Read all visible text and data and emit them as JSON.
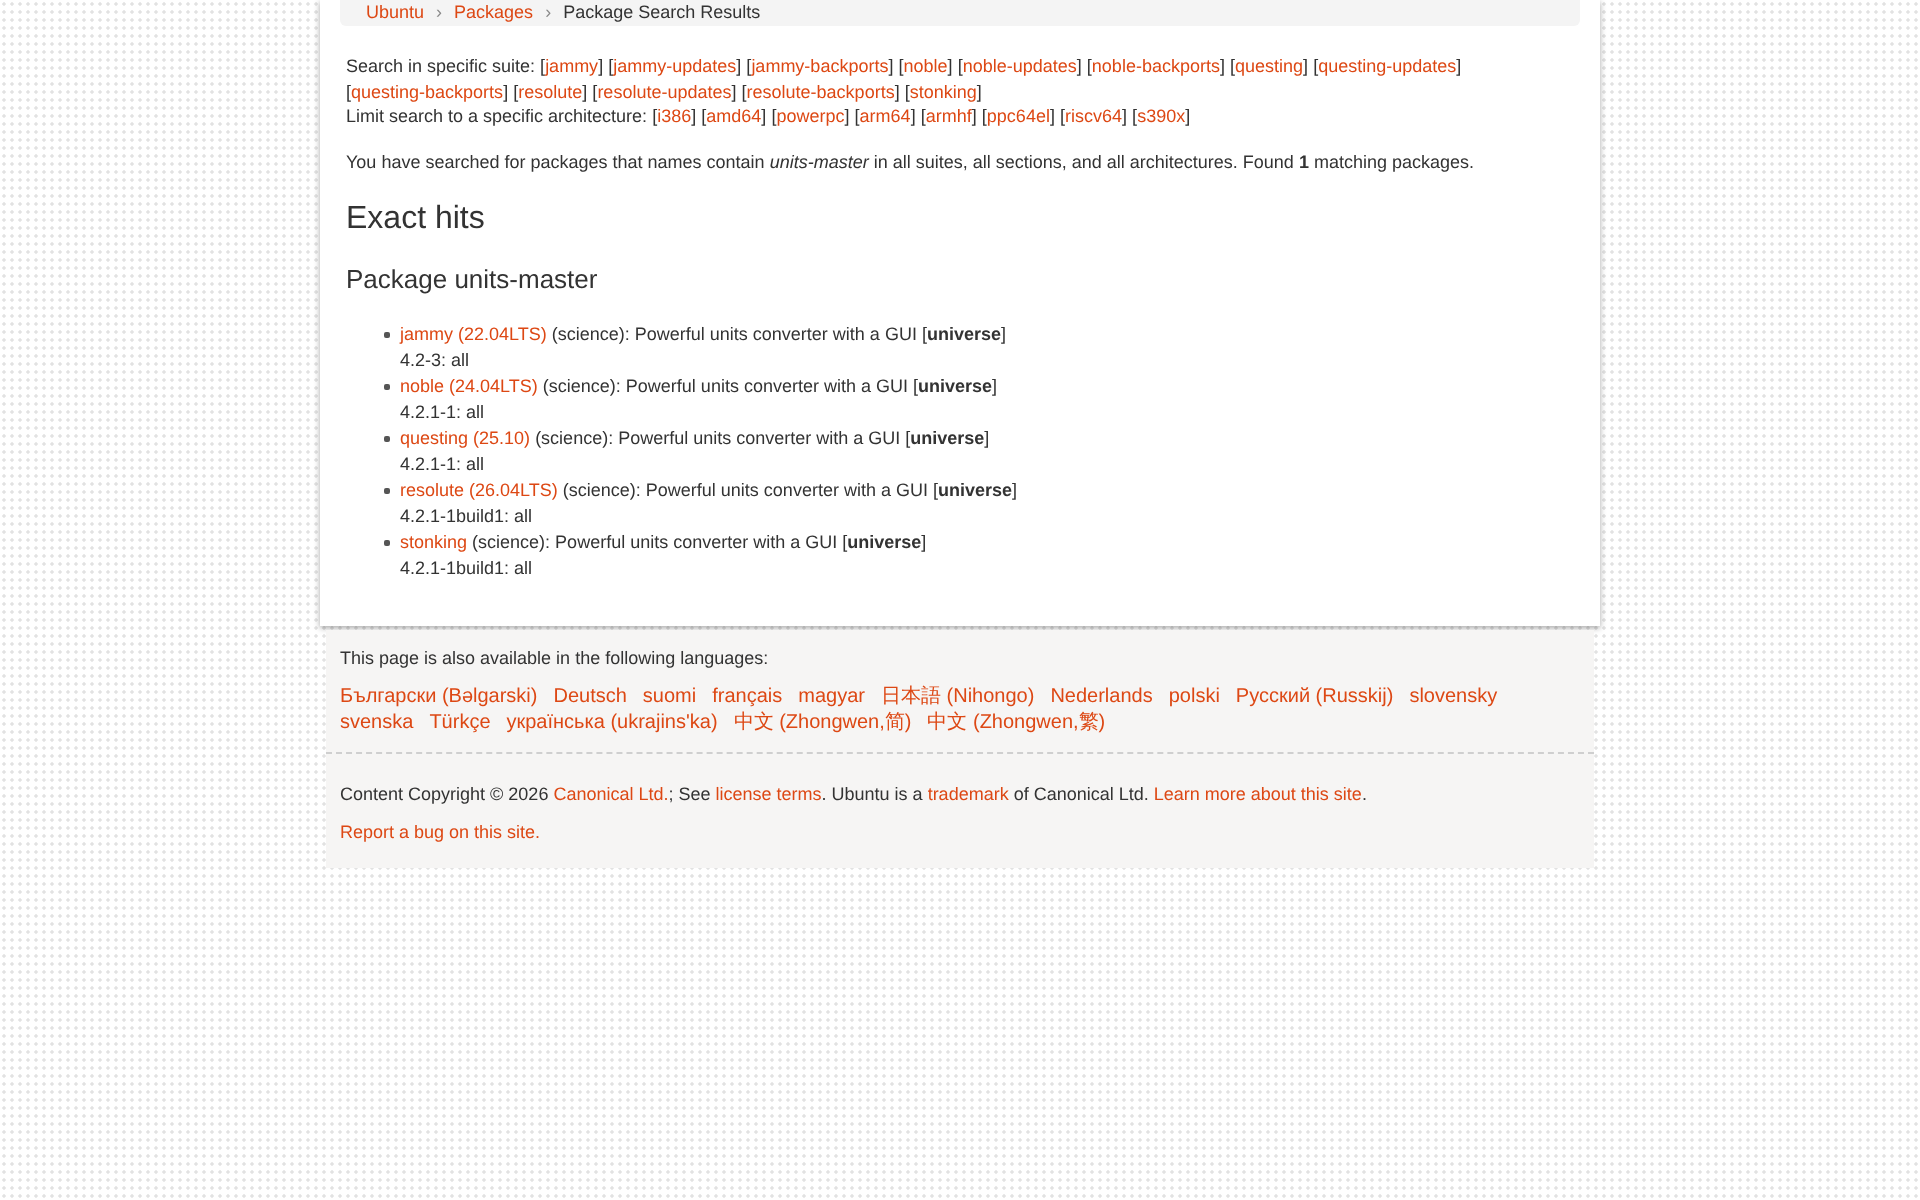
{
  "breadcrumb": {
    "separator": "›",
    "items": [
      {
        "label": "Ubuntu",
        "link": true
      },
      {
        "label": "Packages",
        "link": true
      },
      {
        "label": "Package Search Results",
        "link": false
      }
    ]
  },
  "suite_filter": {
    "label": "Search in specific suite:",
    "bracket_open": "[",
    "bracket_close": "]",
    "options": [
      "jammy",
      "jammy-updates",
      "jammy-backports",
      "noble",
      "noble-updates",
      "noble-backports",
      "questing",
      "questing-updates",
      "questing-backports",
      "resolute",
      "resolute-updates",
      "resolute-backports",
      "stonking"
    ]
  },
  "architecture_filter": {
    "label": "Limit search to a specific architecture:",
    "bracket_open": "[",
    "bracket_close": "]",
    "options": [
      "i386",
      "amd64",
      "powerpc",
      "arm64",
      "armhf",
      "ppc64el",
      "riscv64",
      "s390x"
    ]
  },
  "search_summary": "You have searched for packages that names contain *units-master* in all suites, all sections, and all architectures. Found **1** matching packages.",
  "results_heading": "Exact hits",
  "package_heading": "Package units-master",
  "results": [
    {
      "release": "jammy (22.04LTS)",
      "description": "(science): Powerful units converter with a GUI [**universe**]",
      "versions": "4.2-3: all"
    },
    {
      "release": "noble (24.04LTS)",
      "description": "(science): Powerful units converter with a GUI [**universe**]",
      "versions": "4.2.1-1: all"
    },
    {
      "release": "questing (25.10)",
      "description": "(science): Powerful units converter with a GUI [**universe**]",
      "versions": "4.2.1-1: all"
    },
    {
      "release": "resolute (26.04LTS)",
      "description": "(science): Powerful units converter with a GUI [**universe**]",
      "versions": "4.2.1-1build1: all"
    },
    {
      "release": "stonking",
      "description": "(science): Powerful units converter with a GUI [**universe**]",
      "versions": "4.2.1-1build1: all"
    }
  ],
  "footer": {
    "languages_label": "This page is also available in the following languages:",
    "languages": [
      "Български (Bəlgarski)",
      "Deutsch",
      "suomi",
      "français",
      "magyar",
      "日本語 (Nihongo)",
      "Nederlands",
      "polski",
      "Русский (Russkij)",
      "slovensky",
      "svenska",
      "Türkçe",
      "українська (ukrajins'ka)",
      "中文 (Zhongwen,简)",
      "中文 (Zhongwen,繁)"
    ],
    "copyright": [
      {
        "kind": "text",
        "text": "Content Copyright © 2026 "
      },
      {
        "kind": "link",
        "text": "Canonical Ltd."
      },
      {
        "kind": "text",
        "text": "; See "
      },
      {
        "kind": "link",
        "text": "license terms"
      },
      {
        "kind": "text",
        "text": ". Ubuntu is a "
      },
      {
        "kind": "link",
        "text": "trademark"
      },
      {
        "kind": "text",
        "text": " of Canonical Ltd. "
      },
      {
        "kind": "link",
        "text": "Learn more about this site"
      },
      {
        "kind": "text",
        "text": "."
      }
    ],
    "report_bug": "Report a bug on this site."
  }
}
